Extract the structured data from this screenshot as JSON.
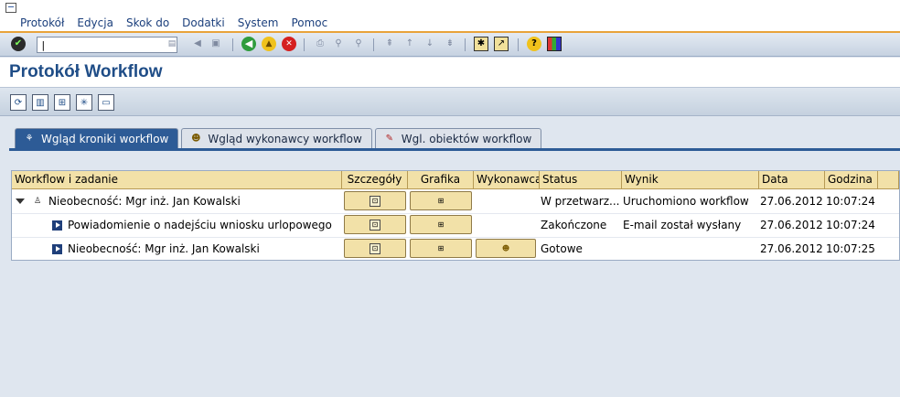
{
  "menu": [
    "Protokół",
    "Edycja",
    "Skok do",
    "Dodatki",
    "System",
    "Pomoc"
  ],
  "command_field": {
    "value": "|",
    "placeholder": ""
  },
  "page": {
    "title": "Protokół Workflow"
  },
  "tabs": [
    {
      "label": "Wgląd kroniki workflow",
      "icon": "chronicle-icon",
      "active": true
    },
    {
      "label": "Wgląd wykonawcy workflow",
      "icon": "agents-icon",
      "active": false
    },
    {
      "label": "Wgl. obiektów workflow",
      "icon": "objects-icon",
      "active": false
    }
  ],
  "table": {
    "columns": [
      "Workflow i zadanie",
      "Szczegóły",
      "Grafika",
      "Wykonawca",
      "Status",
      "Wynik",
      "Data",
      "Godzina"
    ],
    "rows": [
      {
        "task": "Nieobecność: Mgr inż. Jan Kowalski",
        "status": "W przetwarz...",
        "result": "Uruchomiono workflow",
        "date": "27.06.2012",
        "time": "10:07:24"
      },
      {
        "task": "Powiadomienie o nadejściu wniosku urlopowego",
        "status": "Zakończone",
        "result": "E-mail został wysłany",
        "date": "27.06.2012",
        "time": "10:07:24"
      },
      {
        "task": "Nieobecność: Mgr inż. Jan Kowalski",
        "status": "Gotowe",
        "result": "",
        "date": "27.06.2012",
        "time": "10:07:25"
      }
    ]
  },
  "colors": {
    "accent": "#2d5b96",
    "header": "#f2e1a8",
    "title": "#1f4d87"
  }
}
